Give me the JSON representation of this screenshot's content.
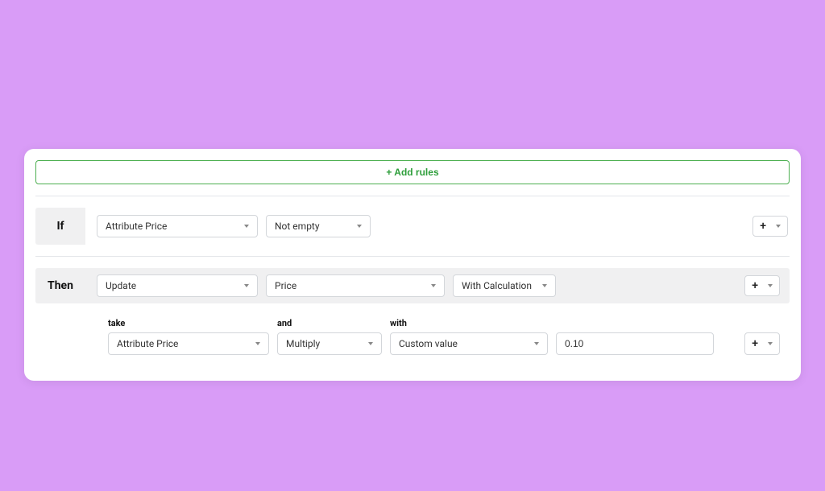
{
  "addRulesLabel": "+ Add rules",
  "ifLabel": "If",
  "thenLabel": "Then",
  "plusGlyph": "+",
  "ifCondition": {
    "attribute": "Attribute Price",
    "operator": "Not empty"
  },
  "thenAction": {
    "action": "Update",
    "target": "Price",
    "mode": "With Calculation"
  },
  "calculation": {
    "takeLabel": "take",
    "andLabel": "and",
    "withLabel": "with",
    "take": "Attribute Price",
    "operation": "Multiply",
    "withSource": "Custom value",
    "value": "0.10"
  }
}
